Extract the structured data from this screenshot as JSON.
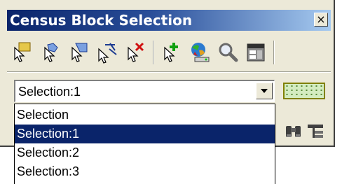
{
  "window": {
    "title": "Census Block Selection",
    "close_glyph": "×"
  },
  "toolbar": {
    "buttons": [
      {
        "icon": "select-features-icon"
      },
      {
        "icon": "select-by-point-icon"
      },
      {
        "icon": "select-by-polygon-icon"
      },
      {
        "icon": "select-by-line-icon"
      },
      {
        "icon": "clear-selection-icon"
      },
      {
        "icon": "add-to-selection-icon"
      },
      {
        "icon": "color-globe-icon"
      },
      {
        "icon": "zoom-to-selection-icon"
      },
      {
        "icon": "table-view-icon"
      }
    ]
  },
  "selection": {
    "current": "Selection:1",
    "options": [
      "Selection",
      "Selection:1",
      "Selection:2",
      "Selection:3"
    ],
    "selected_index": 1
  },
  "colors": {
    "titlebar_start": "#0a246a",
    "highlight": "#0a246a",
    "panel": "#ece9d8"
  }
}
